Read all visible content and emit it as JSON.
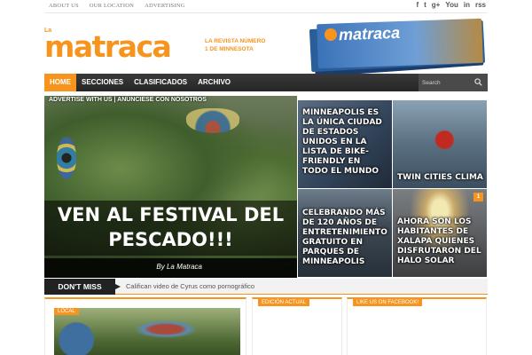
{
  "topbar": {
    "links": [
      "ABOUT US",
      "OUR LOCATION",
      "ADVERTISING"
    ],
    "social_icons": [
      "facebook-icon",
      "twitter-icon",
      "googleplus-icon",
      "youtube-icon",
      "linkedin-icon",
      "rss-icon"
    ],
    "social_glyphs": [
      "f",
      "t",
      "g+",
      "You",
      "in",
      "rss"
    ]
  },
  "header": {
    "logo_prefix": "La",
    "logo_main": "matraca",
    "tagline": "La revista número 1 de Minnesota",
    "magazine_cover_title": "matraca"
  },
  "nav": {
    "items": [
      "HOME",
      "SECCIONES",
      "CLASIFICADOS",
      "ARCHIVO"
    ],
    "active_index": 0,
    "search_placeholder": "Search"
  },
  "hero": {
    "advert": "ADVERTISE WITH US | ANÚNCIESE CON NOSOTROS",
    "title": "VEN AL FESTIVAL DEL PESCADO!!!",
    "byline": "By La Matraca"
  },
  "tiles": [
    {
      "caption": "MINNEAPOLIS ES LA ÚNICA CIUDAD DE ESTADOS UNIDOS EN LA LISTA DE BIKE-FRIENDLY EN TODO EL MUNDO"
    },
    {
      "caption": "TWIN CITIES CLIMA"
    },
    {
      "caption": "CELEBRANDO MÁS DE 120 AÑOS DE ENTRETENIMIENTO GRATUITO EN PARQUES DE MINNEAPOLIS"
    },
    {
      "caption": "AHORA SON LOS HABITANTES DE XALAPA QUIENES DISFRUTARON DEL HALO SOLAR",
      "comment_count": "1"
    }
  ],
  "dont_miss": {
    "label": "DON'T MISS",
    "headline": "Califican video de Cyrus como pornográfico"
  },
  "widgets": {
    "local_tag": "LOCAL",
    "edicion_label": "EDICIÓN ACTUAL",
    "facebook_label": "LIKE US ON FACEBOOK!"
  },
  "colors": {
    "accent": "#f7941d",
    "nav_bg": "#2a2a2a"
  }
}
